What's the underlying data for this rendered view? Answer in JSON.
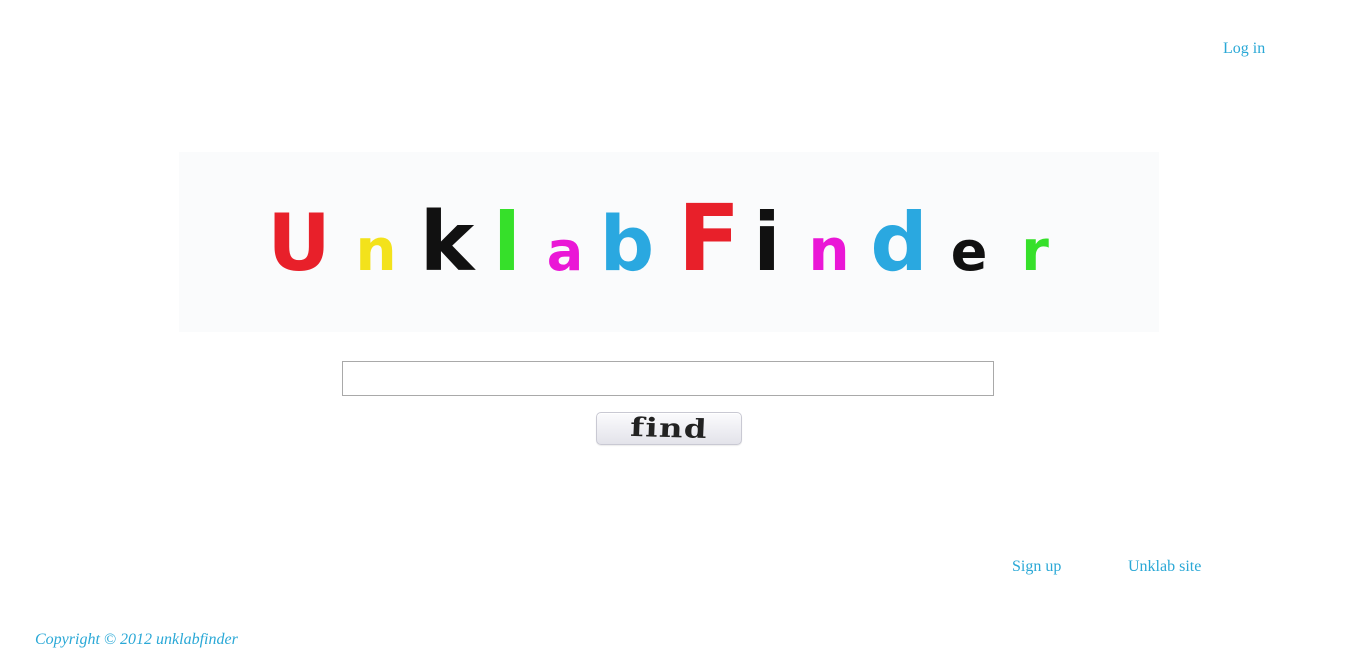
{
  "header": {
    "login_label": "Log in"
  },
  "logo": {
    "text": "UnklabFinder",
    "letters": [
      {
        "char": "U",
        "color": "#e8202a"
      },
      {
        "char": "n",
        "color": "#f3e21b"
      },
      {
        "char": "k",
        "color": "#111111"
      },
      {
        "char": "l",
        "color": "#36e02a"
      },
      {
        "char": "a",
        "color": "#ea17d6"
      },
      {
        "char": "b",
        "color": "#2aa8e0"
      },
      {
        "char": "F",
        "color": "#e8202a"
      },
      {
        "char": "i",
        "color": "#111111"
      },
      {
        "char": "n",
        "color": "#ea17d6"
      },
      {
        "char": "d",
        "color": "#2aa8e0"
      },
      {
        "char": "e",
        "color": "#111111"
      },
      {
        "char": "r",
        "color": "#36e02a"
      }
    ]
  },
  "search": {
    "value": "",
    "placeholder": "",
    "button_label": "find"
  },
  "footer": {
    "signup_label": "Sign up",
    "unklab_site_label": "Unklab site",
    "copyright": "Copyright © 2012 unklabfinder"
  },
  "colors": {
    "link": "#2aa8d6",
    "logo_background": "#fafbfc",
    "input_border": "#a9a9a9"
  }
}
